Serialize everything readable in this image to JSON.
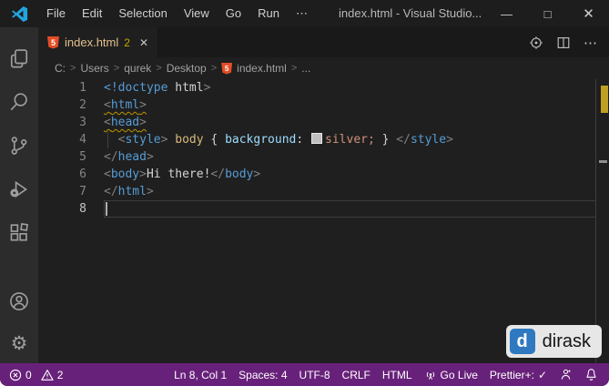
{
  "window": {
    "title": "index.html - Visual Studio...",
    "controls": {
      "minimize": "—",
      "maximize": "□",
      "close": "✕"
    }
  },
  "menu": {
    "items": [
      "File",
      "Edit",
      "Selection",
      "View",
      "Go",
      "Run",
      "⋯"
    ]
  },
  "tab": {
    "file": "index.html",
    "badge": "2",
    "close": "✕",
    "file_icon": "html5-icon"
  },
  "editor_actions": {
    "more": "⋯"
  },
  "breadcrumb": {
    "segments": [
      "C:",
      "Users",
      "qurek",
      "Desktop"
    ],
    "file": "index.html",
    "more": "...",
    "chevron": ">"
  },
  "code": {
    "lines": [
      {
        "num": "1",
        "tokens": [
          [
            "tag",
            "<!doctype"
          ],
          [
            "plain",
            " html"
          ],
          [
            "punct",
            ">"
          ]
        ]
      },
      {
        "num": "2",
        "tokens": [
          [
            "punct sq",
            "<"
          ],
          [
            "tag sq",
            "html"
          ],
          [
            "punct sq",
            ">"
          ]
        ]
      },
      {
        "num": "3",
        "tokens": [
          [
            "punct sq",
            "<"
          ],
          [
            "tag sq",
            "head"
          ],
          [
            "punct sq",
            ">"
          ]
        ]
      },
      {
        "num": "4",
        "guide": true,
        "tokens": [
          [
            "plain",
            "  "
          ],
          [
            "punct",
            "<"
          ],
          [
            "tag",
            "style"
          ],
          [
            "punct",
            ">"
          ],
          [
            "plain",
            " "
          ],
          [
            "sel",
            "body"
          ],
          [
            "plain",
            " { "
          ],
          [
            "prop",
            "background"
          ],
          [
            "plain",
            ": "
          ],
          [
            "swatch",
            ""
          ],
          [
            "val",
            "silver;"
          ],
          [
            "plain",
            " } "
          ],
          [
            "punct",
            "</"
          ],
          [
            "tag",
            "style"
          ],
          [
            "punct",
            ">"
          ]
        ]
      },
      {
        "num": "5",
        "tokens": [
          [
            "punct",
            "</"
          ],
          [
            "tag",
            "head"
          ],
          [
            "punct",
            ">"
          ]
        ]
      },
      {
        "num": "6",
        "tokens": [
          [
            "punct",
            "<"
          ],
          [
            "tag",
            "body"
          ],
          [
            "punct",
            ">"
          ],
          [
            "plain",
            "Hi there!"
          ],
          [
            "punct",
            "</"
          ],
          [
            "tag",
            "body"
          ],
          [
            "punct",
            ">"
          ]
        ]
      },
      {
        "num": "7",
        "tokens": [
          [
            "punct",
            "</"
          ],
          [
            "tag",
            "html"
          ],
          [
            "punct",
            ">"
          ]
        ]
      },
      {
        "num": "8",
        "current": true,
        "tokens": []
      }
    ]
  },
  "status_bar": {
    "errors": "0",
    "warnings": "2",
    "line_col": "Ln 8, Col 1",
    "spaces": "Spaces: 4",
    "encoding": "UTF-8",
    "eol": "CRLF",
    "language": "HTML",
    "go_live": "Go Live",
    "prettier": "Prettier+:",
    "prettier_check": "✓"
  },
  "watermark": {
    "initial": "d",
    "text": "dirask"
  },
  "icons": {
    "activity_bar": [
      "explorer-icon",
      "search-icon",
      "source-control-icon",
      "run-debug-icon",
      "extensions-icon",
      "account-icon",
      "settings-gear-icon"
    ],
    "settings_gear_glyph": "⚙"
  },
  "colors": {
    "statusbar": "#68217a",
    "tab_modified": "#e2c08d",
    "warning": "#cca700",
    "html5_orange": "#e44d26",
    "dirask_blue": "#2e79c0",
    "editor_bg": "#1f1f1f"
  }
}
